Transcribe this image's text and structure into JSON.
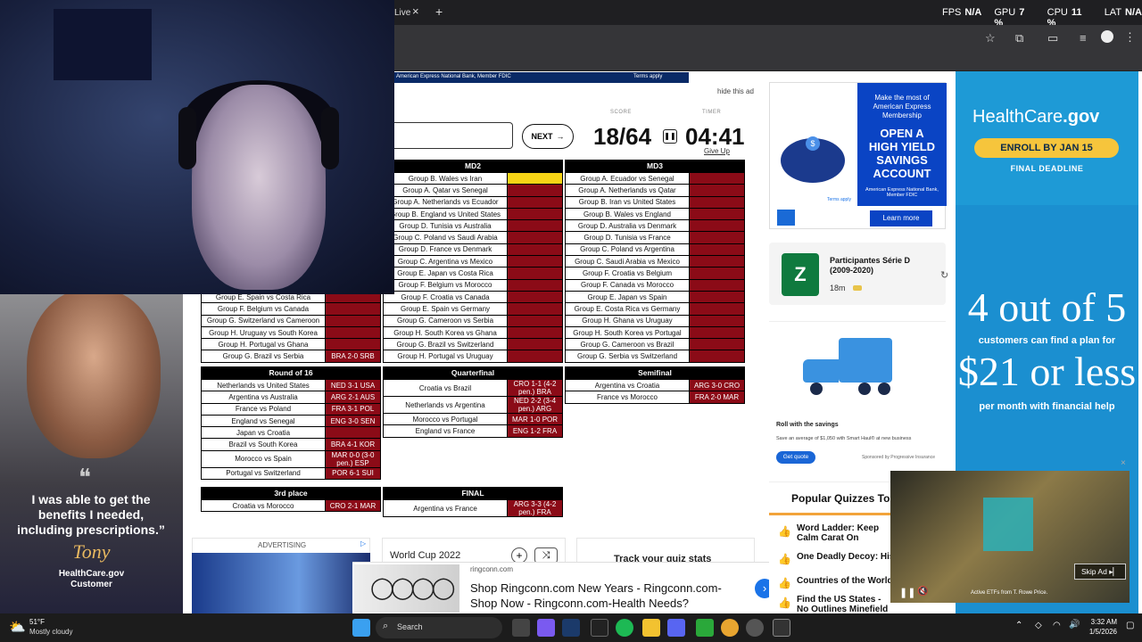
{
  "browser": {
    "tab_fragment": "Live",
    "new_tab": "+",
    "stats": [
      {
        "label": "FPS",
        "value": "N/A"
      },
      {
        "label": "GPU",
        "value": "7 %"
      },
      {
        "label": "CPU",
        "value": "11 %"
      },
      {
        "label": "LAT",
        "value": "N/A"
      }
    ]
  },
  "top_ad_strip": {
    "text": "American Express National Bank, Member FDIC",
    "terms": "Terms apply"
  },
  "hide_ad": "hide this ad",
  "quiz": {
    "next_label": "NEXT",
    "score_label": "SCORE",
    "timer_label": "TIMER",
    "score": "18/64",
    "timer": "04:41",
    "give_up": "Give Up",
    "md1_partial": [
      {
        "m": "Group E. Spain vs Costa Rica",
        "a": "",
        "c": "r"
      },
      {
        "m": "Group F. Belgium vs Canada",
        "a": "",
        "c": "r"
      },
      {
        "m": "Group G. Switzerland vs Cameroon",
        "a": "",
        "c": "r"
      },
      {
        "m": "Group H. Uruguay vs South Korea",
        "a": "",
        "c": "r"
      },
      {
        "m": "Group H. Portugal vs Ghana",
        "a": "",
        "c": "r"
      },
      {
        "m": "Group G. Brazil vs Serbia",
        "a": "BRA 2-0 SRB",
        "c": "r"
      }
    ],
    "md2_title": "MD2",
    "md2": [
      {
        "m": "Group B. Wales vs Iran",
        "a": "",
        "c": "y"
      },
      {
        "m": "Group A. Qatar vs Senegal",
        "a": "",
        "c": "r"
      },
      {
        "m": "Group A. Netherlands vs Ecuador",
        "a": "",
        "c": "r"
      },
      {
        "m": "Group B. England vs United States",
        "a": "",
        "c": "r"
      },
      {
        "m": "Group D. Tunisia vs Australia",
        "a": "",
        "c": "r"
      },
      {
        "m": "Group C. Poland vs Saudi Arabia",
        "a": "",
        "c": "r"
      },
      {
        "m": "Group D. France vs Denmark",
        "a": "",
        "c": "r"
      },
      {
        "m": "Group C. Argentina vs Mexico",
        "a": "",
        "c": "r"
      },
      {
        "m": "Group E. Japan vs Costa Rica",
        "a": "",
        "c": "r"
      },
      {
        "m": "Group F. Belgium vs Morocco",
        "a": "",
        "c": "r"
      },
      {
        "m": "Group F. Croatia vs Canada",
        "a": "",
        "c": "r"
      },
      {
        "m": "Group E. Spain vs Germany",
        "a": "",
        "c": "r"
      },
      {
        "m": "Group G. Cameroon vs Serbia",
        "a": "",
        "c": "r"
      },
      {
        "m": "Group H. South Korea vs Ghana",
        "a": "",
        "c": "r"
      },
      {
        "m": "Group G. Brazil vs Switzerland",
        "a": "",
        "c": "r"
      },
      {
        "m": "Group H. Portugal vs Uruguay",
        "a": "",
        "c": "r"
      }
    ],
    "md3_title": "MD3",
    "md3": [
      {
        "m": "Group A. Ecuador vs Senegal",
        "a": "",
        "c": "r"
      },
      {
        "m": "Group A. Netherlands vs Qatar",
        "a": "",
        "c": "r"
      },
      {
        "m": "Group B. Iran vs United States",
        "a": "",
        "c": "r"
      },
      {
        "m": "Group B. Wales vs England",
        "a": "",
        "c": "r"
      },
      {
        "m": "Group D. Australia vs Denmark",
        "a": "",
        "c": "r"
      },
      {
        "m": "Group D. Tunisia vs France",
        "a": "",
        "c": "r"
      },
      {
        "m": "Group C. Poland vs Argentina",
        "a": "",
        "c": "r"
      },
      {
        "m": "Group C. Saudi Arabia vs Mexico",
        "a": "",
        "c": "r"
      },
      {
        "m": "Group F. Croatia vs Belgium",
        "a": "",
        "c": "r"
      },
      {
        "m": "Group F. Canada vs Morocco",
        "a": "",
        "c": "r"
      },
      {
        "m": "Group E. Japan vs Spain",
        "a": "",
        "c": "r"
      },
      {
        "m": "Group E. Costa Rica vs Germany",
        "a": "",
        "c": "r"
      },
      {
        "m": "Group H. Ghana vs Uruguay",
        "a": "",
        "c": "r"
      },
      {
        "m": "Group H. South Korea vs Portugal",
        "a": "",
        "c": "r"
      },
      {
        "m": "Group G. Cameroon vs Brazil",
        "a": "",
        "c": "r"
      },
      {
        "m": "Group G. Serbia vs Switzerland",
        "a": "",
        "c": "r"
      }
    ],
    "r16_title": "Round of 16",
    "r16": [
      {
        "m": "Netherlands vs United States",
        "a": "NED 3-1 USA"
      },
      {
        "m": "Argentina vs Australia",
        "a": "ARG 2-1 AUS"
      },
      {
        "m": "France vs Poland",
        "a": "FRA 3-1 POL"
      },
      {
        "m": "England vs Senegal",
        "a": "ENG 3-0 SEN"
      },
      {
        "m": "Japan vs Croatia",
        "a": ""
      },
      {
        "m": "Brazil vs South Korea",
        "a": "BRA 4-1 KOR"
      },
      {
        "m": "Morocco vs Spain",
        "a": "MAR 0-0 (3-0 pen.) ESP"
      },
      {
        "m": "Portugal vs Switzerland",
        "a": "POR 6-1 SUI"
      }
    ],
    "qf_title": "Quarterfinal",
    "qf": [
      {
        "m": "Croatia vs Brazil",
        "a": "CRO 1-1 (4-2 pen.) BRA"
      },
      {
        "m": "Netherlands vs Argentina",
        "a": "NED 2-2 (3-4 pen.) ARG"
      },
      {
        "m": "Morocco vs Portugal",
        "a": "MAR 1-0 POR"
      },
      {
        "m": "England vs France",
        "a": "ENG 1-2 FRA"
      }
    ],
    "sf_title": "Semifinal",
    "sf": [
      {
        "m": "Argentina vs Croatia",
        "a": "ARG 3-0 CRO"
      },
      {
        "m": "France vs Morocco",
        "a": "FRA 2-0 MAR"
      }
    ],
    "third_title": "3rd place",
    "third": [
      {
        "m": "Croatia vs Morocco",
        "a": "CRO 2-1 MAR"
      }
    ],
    "final_title": "FINAL",
    "final": [
      {
        "m": "Argentina vs France",
        "a": "ARG 3-3 (4-2 pen.) FRA"
      }
    ]
  },
  "bottom": {
    "advertising": "ADVERTISING",
    "quiz_title": "World Cup 2022",
    "track": "Track your quiz stats"
  },
  "amex": {
    "line1": "Make the most of American Express Membership",
    "headline": "OPEN A HIGH YIELD SAVINGS ACCOUNT",
    "fine": "American Express National Bank, Member FDIC",
    "terms": "Terms apply",
    "cta": "Learn more"
  },
  "serie_d": {
    "title": "Participantes Série D (2009-2020)",
    "time": "18m"
  },
  "progressive": {
    "headline": "Roll with the savings",
    "body": "Save an average of $1,050 with Smart Haul® at new business",
    "cta": "Get quote",
    "sponsor": "Sponsored by Progressive Insurance"
  },
  "popular": {
    "title": "Popular Quizzes To",
    "items": [
      "Word Ladder: Keep Calm Carat On",
      "One Deadly Decoy: Histo",
      "Countries of the World",
      "Find the US States - No Outlines Minefield"
    ]
  },
  "healthcare": {
    "logo_a": "HealthCare",
    "logo_b": ".gov",
    "enroll": "ENROLL BY JAN 15",
    "deadline": "FINAL DEADLINE",
    "big1": "4 out of 5",
    "sub1": "customers can find a plan for",
    "big2": "$21 or less",
    "sub2": "per month with financial help"
  },
  "testimonial": {
    "quote": "I was able to get the benefits I needed, including prescriptions.”",
    "name": "Tony",
    "org": "HealthCare.gov",
    "role": "Customer"
  },
  "video_ad": {
    "skip": "Skip Ad",
    "caption": "Active ETFs from T. Rowe Price."
  },
  "ringconn": {
    "domain": "ringconn.com",
    "headline": "Shop Ringconn.com New Years - Ringconn.com- Shop Now - Ringconn.com-Health Needs?"
  },
  "taskbar": {
    "temp": "51°F",
    "weather": "Mostly cloudy",
    "search": "Search",
    "time": "3:32 AM",
    "date": "1/5/2026"
  }
}
